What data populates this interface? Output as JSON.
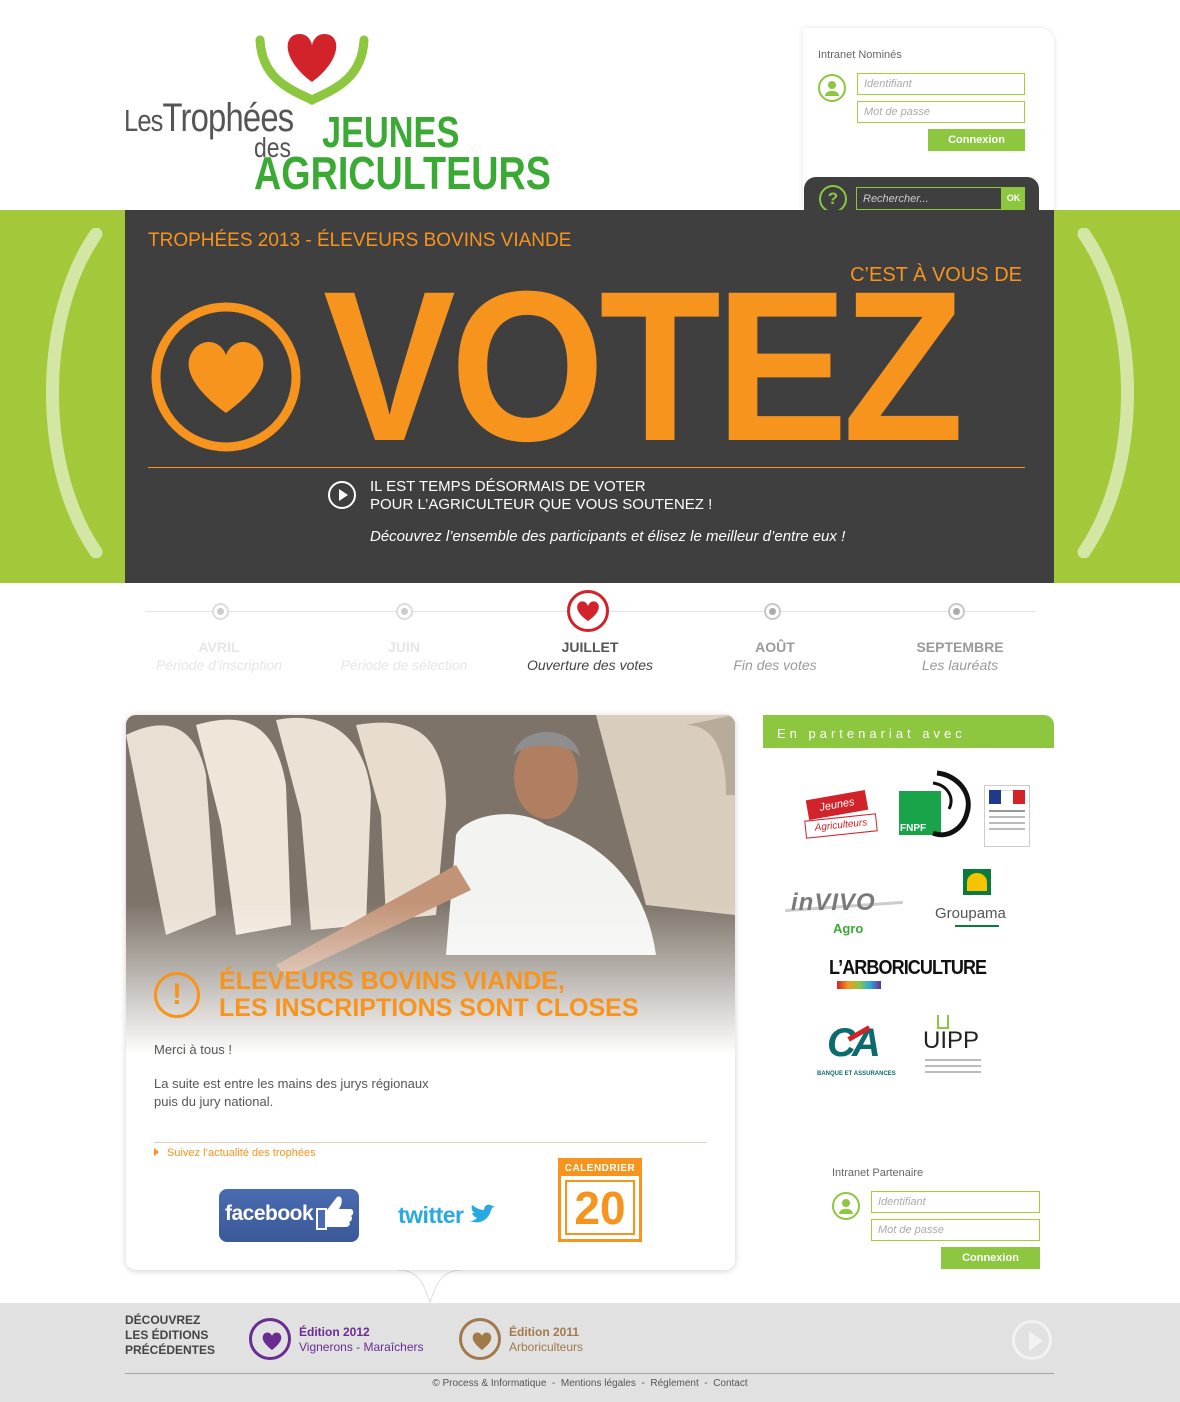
{
  "logo": {
    "les": "Les",
    "trophees": "Trophées",
    "des": "des",
    "jeunes": "JEUNES",
    "agriculteurs": "AGRICULTEURS"
  },
  "login_nomines": {
    "title": "Intranet Nominés",
    "id_placeholder": "Identifiant",
    "pwd_placeholder": "Mot de passe",
    "button": "Connexion"
  },
  "search": {
    "placeholder": "Rechercher...",
    "ok": "OK"
  },
  "hero": {
    "subtitle": "TROPHÉES 2013 - ÉLEVEURS BOVINS VIANDE",
    "cest": "C’EST À VOUS DE",
    "votez": "VOTEZ",
    "line1": "IL EST TEMPS DÉSORMAIS DE VOTER",
    "line2": "POUR L’AGRICULTEUR QUE VOUS SOUTENEZ !",
    "line3": "Découvrez l’ensemble des participants et élisez le meilleur d’entre eux !"
  },
  "timeline": [
    {
      "month": "AVRIL",
      "desc": "Période d’inscription",
      "state": "past"
    },
    {
      "month": "JUIN",
      "desc": "Période de sélection",
      "state": "past"
    },
    {
      "month": "JUILLET",
      "desc": "Ouverture des votes",
      "state": "active"
    },
    {
      "month": "AOÛT",
      "desc": "Fin des votes",
      "state": "future"
    },
    {
      "month": "SEPTEMBRE",
      "desc": "Les lauréats",
      "state": "future"
    }
  ],
  "news": {
    "title_line1": "ÉLEVEURS BOVINS VIANDE,",
    "title_line2": "LES INSCRIPTIONS SONT CLOSES",
    "p1": "Merci à tous !",
    "p2_line1": "La suite est entre les mains des jurys régionaux",
    "p2_line2": "puis du jury national.",
    "follow_link": "Suivez l’actualité des trophées",
    "facebook": "facebook",
    "twitter": "twitter",
    "calendar_label": "CALENDRIER",
    "calendar_number": "20"
  },
  "partners": {
    "title": "En partenariat avec",
    "logos": {
      "ja_line1": "Jeunes",
      "ja_line2": "Agriculteurs",
      "fnpf": "FNPF",
      "invivo": "inVIVO",
      "invivo_sub": "Agro",
      "groupama": "Groupama",
      "arboriculture": "L’ARBORICULTURE",
      "ca": "CA",
      "ca_sub": "BANQUE ET ASSURANCES",
      "uipp": "UIPP"
    }
  },
  "login_partenaire": {
    "title": "Intranet Partenaire",
    "id_placeholder": "Identifiant",
    "pwd_placeholder": "Mot de passe",
    "button": "Connexion"
  },
  "footer": {
    "discover_line1": "DÉCOUVREZ",
    "discover_line2": "LES ÉDITIONS",
    "discover_line3": "PRÉCÉDENTES",
    "ed2012_title": "Édition 2012",
    "ed2012_sub": "Vignerons - Maraîchers",
    "ed2011_title": "Édition 2011",
    "ed2011_sub": "Arboriculteurs",
    "links": [
      "© Process & Informatique",
      "Mentions légales",
      "Réglement",
      "Contact"
    ],
    "colors": {
      "ed2012": "#6a2c91",
      "ed2011": "#a17a4a"
    }
  },
  "colors": {
    "green": "#8dc63f",
    "orange": "#f7941e",
    "dark": "#3f3f40",
    "red": "#d2232a"
  }
}
